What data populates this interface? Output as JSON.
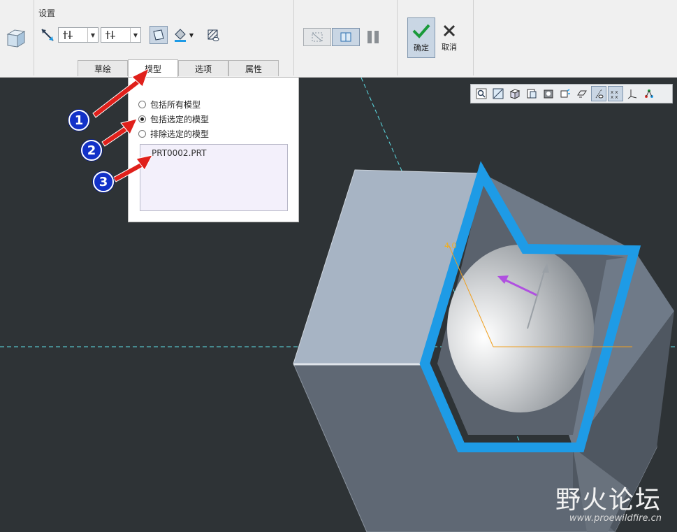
{
  "ribbon": {
    "group_label": "设置",
    "confirm_label": "确定",
    "cancel_label": "取消"
  },
  "tabs": [
    {
      "label": "草绘",
      "active": false
    },
    {
      "label": "模型",
      "active": true
    },
    {
      "label": "选项",
      "active": false
    },
    {
      "label": "属性",
      "active": false
    }
  ],
  "panel": {
    "options": [
      {
        "label": "包括所有模型",
        "selected": false
      },
      {
        "label": "包括选定的模型",
        "selected": true
      },
      {
        "label": "排除选定的模型",
        "selected": false
      }
    ],
    "selected_models": [
      "PRT0002.PRT"
    ]
  },
  "annotations": [
    "1",
    "2",
    "3"
  ],
  "watermark": {
    "title": "野火论坛",
    "url": "www.proewildfire.cn"
  },
  "colors": {
    "accent_blue": "#1e9be6",
    "arrow_red": "#e0201b",
    "badge_blue": "#1231c8",
    "viewport_bg": "#2e3336"
  }
}
